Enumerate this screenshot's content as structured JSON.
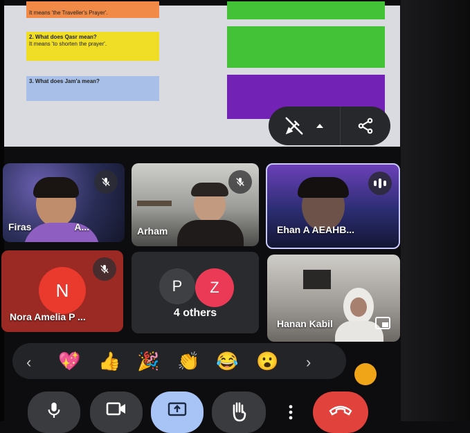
{
  "slide": {
    "q1": {
      "answer": "It means 'the Traveller's Prayer'."
    },
    "q2": {
      "question": "2. What does Qasr mean?",
      "answer": "It means 'to shorten the prayer'."
    },
    "q3": {
      "question": "3. What does Jam'a mean?"
    }
  },
  "colors": {
    "orange": "#f08a46",
    "yellow": "#f0de26",
    "light_blue": "#a8c0e8",
    "green": "#44c237",
    "purple": "#7222b5",
    "end_call_red": "#e2423c",
    "share_active": "#a8c4f6",
    "nora_tile": "#9c2a24"
  },
  "presentation_controls": {
    "annotate_icon": "pen-off-icon",
    "expand_icon": "caret-up-icon",
    "share_icon": "share-icon"
  },
  "participants": [
    {
      "name": "Firas",
      "suffix": "A...",
      "muted": true
    },
    {
      "name": "Arham",
      "muted": true
    },
    {
      "name": "Ehan A AEAHB...",
      "speaking": true
    },
    {
      "name": "Nora Amelia P ...",
      "initial": "N",
      "muted": true
    },
    {
      "label": "4 others",
      "initials": [
        "P",
        "Z"
      ]
    },
    {
      "name": "Hanan Kabil"
    }
  ],
  "reactions": {
    "prev": "‹",
    "items": [
      "💖",
      "👍",
      "🎉",
      "👏",
      "😂",
      "😮"
    ],
    "next": "›"
  },
  "controls": {
    "mic_icon": "microphone-icon",
    "camera_icon": "video-camera-icon",
    "present_icon": "present-screen-icon",
    "hand_icon": "raise-hand-icon",
    "more_icon": "more-vertical-icon",
    "end_icon": "end-call-icon"
  }
}
